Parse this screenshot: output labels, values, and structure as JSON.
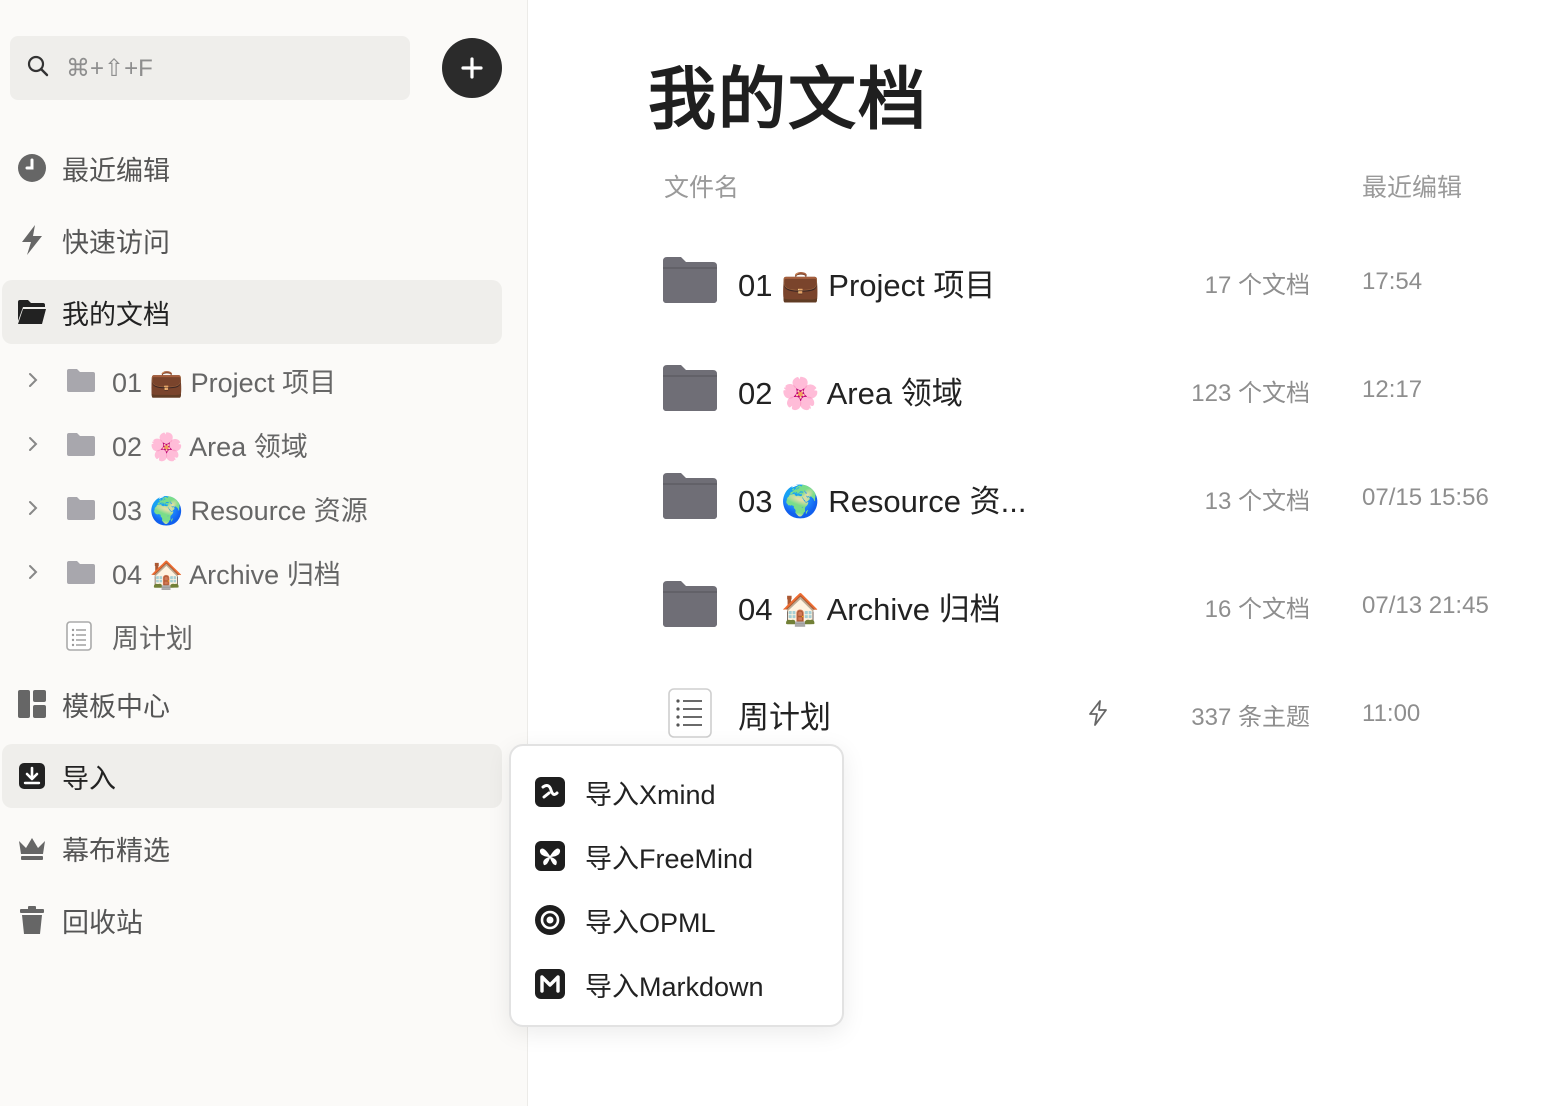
{
  "sidebar": {
    "search": {
      "placeholder": "⌘+⇧+F"
    },
    "add_label": "+",
    "nav": [
      {
        "label": "最近编辑",
        "icon": "clock-icon"
      },
      {
        "label": "快速访问",
        "icon": "bolt-icon"
      },
      {
        "label": "我的文档",
        "icon": "folder-open-icon",
        "active": true
      },
      {
        "label": "模板中心",
        "icon": "template-icon"
      },
      {
        "label": "导入",
        "icon": "import-icon",
        "active": true
      },
      {
        "label": "幕布精选",
        "icon": "crown-icon"
      },
      {
        "label": "回收站",
        "icon": "trash-icon"
      }
    ],
    "tree": [
      {
        "label": "01 💼 Project 项目"
      },
      {
        "label": "02 🌸 Area 领域"
      },
      {
        "label": "03 🌍 Resource 资源"
      },
      {
        "label": "04 🏠 Archive 归档"
      },
      {
        "label": "周计划"
      }
    ]
  },
  "main": {
    "title": "我的文档",
    "columns": {
      "name": "文件名",
      "edited": "最近编辑"
    },
    "rows": [
      {
        "name": "01 💼 Project 项目",
        "count": "17 个文档",
        "time": "17:54"
      },
      {
        "name": "02 🌸 Area 领域",
        "count": "123 个文档",
        "time": "12:17"
      },
      {
        "name": "03 🌍 Resource 资...",
        "count": "13 个文档",
        "time": "07/15 15:56"
      },
      {
        "name": "04 🏠 Archive 归档",
        "count": "16 个文档",
        "time": "07/13 21:45"
      },
      {
        "name": "周计划",
        "count": "337 条主题",
        "time": "11:00"
      }
    ]
  },
  "import_menu": {
    "items": [
      {
        "label": "导入Xmind",
        "icon": "xmind-icon"
      },
      {
        "label": "导入FreeMind",
        "icon": "freemind-icon"
      },
      {
        "label": "导入OPML",
        "icon": "opml-icon"
      },
      {
        "label": "导入Markdown",
        "icon": "markdown-icon"
      }
    ]
  },
  "colors": {
    "sidebar_bg": "#fbfaf8",
    "active_bg": "#efeeeb",
    "folder": "#6f6e76",
    "text_muted": "#8e8e8e"
  }
}
